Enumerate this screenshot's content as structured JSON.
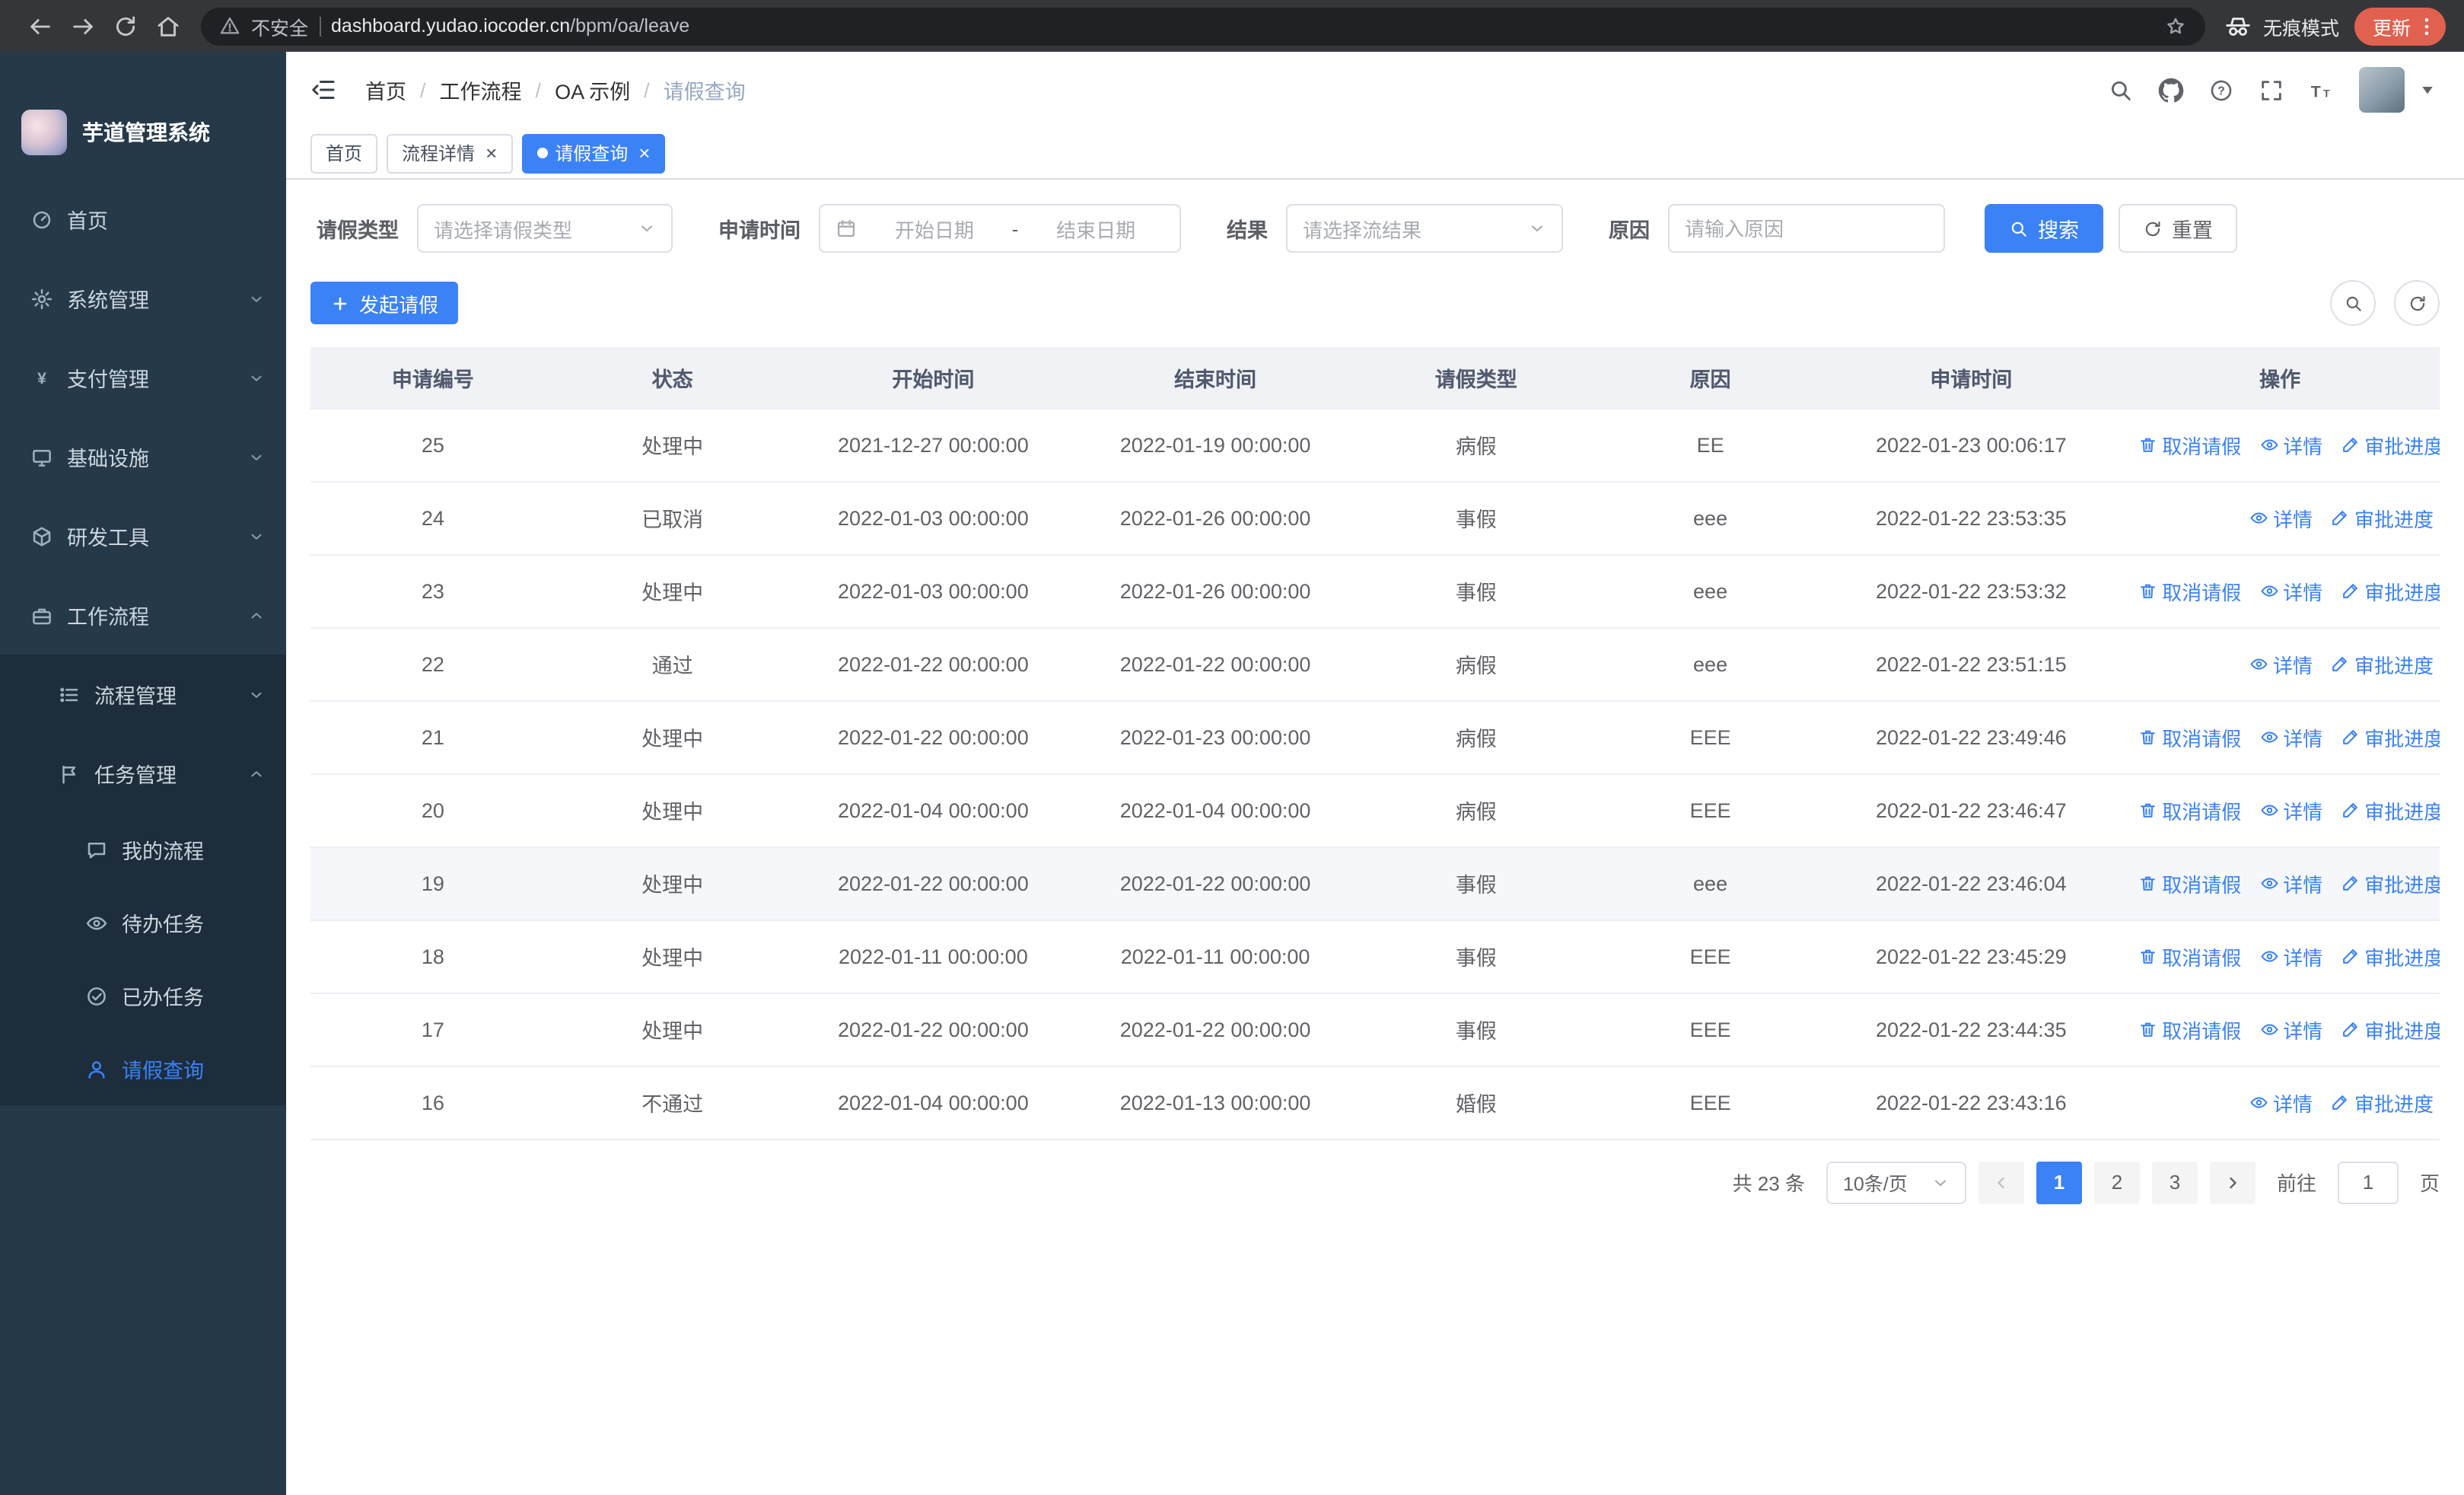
{
  "colors": {
    "primary": "#3b82f6",
    "sidebar_bg": "#253949",
    "submenu_bg": "#1d2d3c",
    "table_header_bg": "#f0f2f6"
  },
  "browser": {
    "security_label": "不安全",
    "url_domain": "dashboard.yudao.iocoder.cn",
    "url_path": "/bpm/oa/leave",
    "incognito_label": "无痕模式",
    "update_label": "更新"
  },
  "sidebar": {
    "app_title": "芋道管理系统",
    "menu": [
      {
        "label": "首页",
        "icon": "dashboard-icon"
      },
      {
        "label": "系统管理",
        "icon": "gear-icon",
        "state": "collapsed"
      },
      {
        "label": "支付管理",
        "icon": "yen-icon",
        "state": "collapsed"
      },
      {
        "label": "基础设施",
        "icon": "monitor-icon",
        "state": "collapsed"
      },
      {
        "label": "研发工具",
        "icon": "cube-icon",
        "state": "collapsed"
      },
      {
        "label": "工作流程",
        "icon": "briefcase-icon",
        "state": "expanded"
      }
    ],
    "submenu": [
      {
        "label": "流程管理",
        "icon": "list-icon",
        "state": "collapsed"
      },
      {
        "label": "任务管理",
        "icon": "flag-icon",
        "state": "expanded"
      },
      {
        "label": "我的流程",
        "icon": "chat-icon"
      },
      {
        "label": "待办任务",
        "icon": "eye-icon"
      },
      {
        "label": "已办任务",
        "icon": "check-circle-icon"
      },
      {
        "label": "请假查询",
        "icon": "user-icon",
        "active": true
      }
    ]
  },
  "header": {
    "breadcrumb": [
      "首页",
      "工作流程",
      "OA 示例",
      "请假查询"
    ],
    "separator": "/"
  },
  "tabs": [
    {
      "label": "首页"
    },
    {
      "label": "流程详情",
      "close": "×"
    },
    {
      "label": "请假查询",
      "close": "×",
      "active": true
    }
  ],
  "filters": {
    "leave_type_label": "请假类型",
    "leave_type_placeholder": "请选择请假类型",
    "apply_time_label": "申请时间",
    "date_start_placeholder": "开始日期",
    "date_separator": "-",
    "date_end_placeholder": "结束日期",
    "result_label": "结果",
    "result_placeholder": "请选择流结果",
    "reason_label": "原因",
    "reason_placeholder": "请输入原因",
    "search_button": "搜索",
    "reset_button": "重置"
  },
  "toolbar": {
    "create_button": "发起请假"
  },
  "table": {
    "columns": [
      "申请编号",
      "状态",
      "开始时间",
      "结束时间",
      "请假类型",
      "原因",
      "申请时间",
      "操作"
    ],
    "action_labels": {
      "cancel": "取消请假",
      "detail": "详情",
      "progress": "审批进度"
    },
    "rows": [
      {
        "id": "25",
        "status": "处理中",
        "start": "2021-12-27 00:00:00",
        "end": "2022-01-19 00:00:00",
        "type": "病假",
        "reason": "EE",
        "applied": "2022-01-23 00:06:17",
        "cancelable": true
      },
      {
        "id": "24",
        "status": "已取消",
        "start": "2022-01-03 00:00:00",
        "end": "2022-01-26 00:00:00",
        "type": "事假",
        "reason": "eee",
        "applied": "2022-01-22 23:53:35",
        "cancelable": false
      },
      {
        "id": "23",
        "status": "处理中",
        "start": "2022-01-03 00:00:00",
        "end": "2022-01-26 00:00:00",
        "type": "事假",
        "reason": "eee",
        "applied": "2022-01-22 23:53:32",
        "cancelable": true
      },
      {
        "id": "22",
        "status": "通过",
        "start": "2022-01-22 00:00:00",
        "end": "2022-01-22 00:00:00",
        "type": "病假",
        "reason": "eee",
        "applied": "2022-01-22 23:51:15",
        "cancelable": false
      },
      {
        "id": "21",
        "status": "处理中",
        "start": "2022-01-22 00:00:00",
        "end": "2022-01-23 00:00:00",
        "type": "病假",
        "reason": "EEE",
        "applied": "2022-01-22 23:49:46",
        "cancelable": true
      },
      {
        "id": "20",
        "status": "处理中",
        "start": "2022-01-04 00:00:00",
        "end": "2022-01-04 00:00:00",
        "type": "病假",
        "reason": "EEE",
        "applied": "2022-01-22 23:46:47",
        "cancelable": true
      },
      {
        "id": "19",
        "status": "处理中",
        "start": "2022-01-22 00:00:00",
        "end": "2022-01-22 00:00:00",
        "type": "事假",
        "reason": "eee",
        "applied": "2022-01-22 23:46:04",
        "cancelable": true,
        "highlighted": true
      },
      {
        "id": "18",
        "status": "处理中",
        "start": "2022-01-11 00:00:00",
        "end": "2022-01-11 00:00:00",
        "type": "事假",
        "reason": "EEE",
        "applied": "2022-01-22 23:45:29",
        "cancelable": true
      },
      {
        "id": "17",
        "status": "处理中",
        "start": "2022-01-22 00:00:00",
        "end": "2022-01-22 00:00:00",
        "type": "事假",
        "reason": "EEE",
        "applied": "2022-01-22 23:44:35",
        "cancelable": true
      },
      {
        "id": "16",
        "status": "不通过",
        "start": "2022-01-04 00:00:00",
        "end": "2022-01-13 00:00:00",
        "type": "婚假",
        "reason": "EEE",
        "applied": "2022-01-22 23:43:16",
        "cancelable": false
      }
    ]
  },
  "pagination": {
    "total_text": "共 23 条",
    "page_size": "10条/页",
    "pages": [
      "1",
      "2",
      "3"
    ],
    "active_page": "1",
    "goto_label": "前往",
    "goto_value": "1",
    "page_label": "页"
  }
}
